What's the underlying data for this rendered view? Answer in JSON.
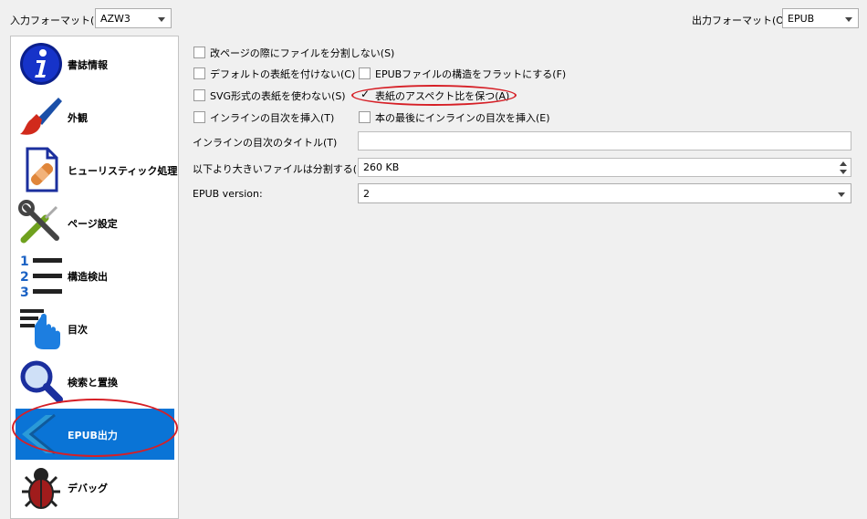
{
  "input_format": {
    "label": "入力フォーマット(I):",
    "value": "AZW3"
  },
  "output_format": {
    "label": "出力フォーマット(O):",
    "value": "EPUB"
  },
  "sidebar": {
    "items": [
      {
        "label": "書誌情報",
        "icon": "info-icon"
      },
      {
        "label": "外観",
        "icon": "paintbrush-icon"
      },
      {
        "label": "ヒューリスティック処理",
        "icon": "document-bandage-icon"
      },
      {
        "label": "ページ設定",
        "icon": "wrench-screwdriver-icon"
      },
      {
        "label": "構造検出",
        "icon": "numbered-list-icon"
      },
      {
        "label": "目次",
        "icon": "toc-pointer-icon"
      },
      {
        "label": "検索と置換",
        "icon": "magnifier-icon"
      },
      {
        "label": "EPUB出力",
        "icon": "chevron-left-icon",
        "selected": true
      },
      {
        "label": "デバッグ",
        "icon": "bug-icon"
      }
    ]
  },
  "options": {
    "no_split_page_breaks": {
      "label": "改ページの際にファイルを分割しない(S)",
      "checked": false
    },
    "no_default_cover": {
      "label": "デフォルトの表紙を付けない(C)",
      "checked": false
    },
    "flatten_structure": {
      "label": "EPUBファイルの構造をフラットにする(F)",
      "checked": false
    },
    "no_svg_cover": {
      "label": "SVG形式の表紙を使わない(S)",
      "checked": false
    },
    "preserve_cover_aspect": {
      "label": "表紙のアスペクト比を保つ(A)",
      "checked": true
    },
    "insert_inline_toc": {
      "label": "インラインの目次を挿入(T)",
      "checked": false
    },
    "toc_at_end": {
      "label": "本の最後にインラインの目次を挿入(E)",
      "checked": false
    }
  },
  "toc_title": {
    "label": "インラインの目次のタイトル(T)",
    "value": ""
  },
  "split_size": {
    "label": "以下より大きいファイルは分割する(L):",
    "value": "260 KB"
  },
  "epub_version": {
    "label": "EPUB version:",
    "value": "2"
  },
  "colors": {
    "selection": "#0a74d6",
    "highlight": "#d61f26"
  }
}
